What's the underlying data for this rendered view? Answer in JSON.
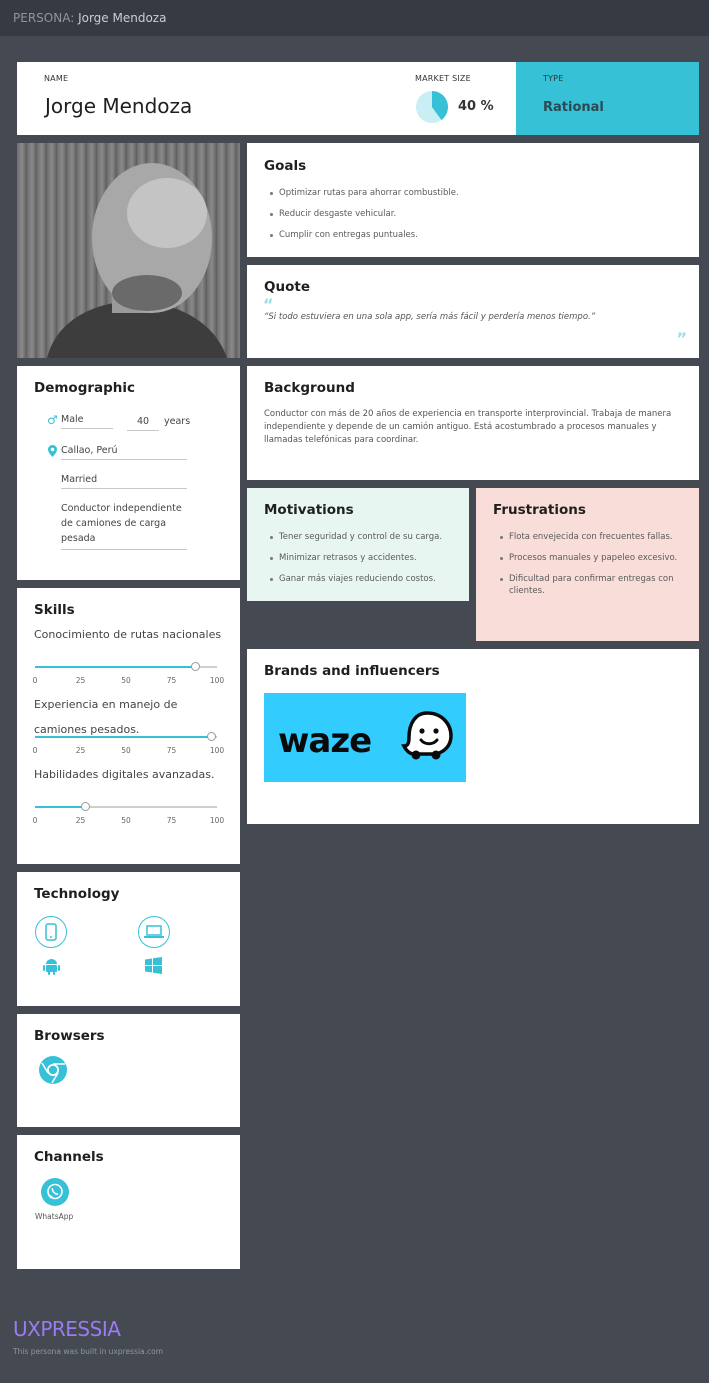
{
  "topbar": {
    "prefix": "PERSONA:",
    "name": "Jorge Mendoza"
  },
  "header": {
    "name_label": "NAME",
    "name": "Jorge Mendoza",
    "market_label": "MARKET SIZE",
    "market_value": "40 %",
    "market_fraction": 0.4,
    "type_label": "TYPE",
    "type_value": "Rational"
  },
  "colors": {
    "accent": "#36c1d6",
    "background": "#454a52",
    "motivations": "#e8f6f1",
    "frustrations": "#f8ddd8",
    "brand": "#9b7bf1"
  },
  "goals": {
    "title": "Goals",
    "items": [
      "Optimizar rutas para ahorrar combustible.",
      "Reducir desgaste vehicular.",
      "Cumplir con entregas puntuales."
    ]
  },
  "quote": {
    "title": "Quote",
    "text": "“Si todo estuviera en una sola app, sería más fácil y perdería menos tiempo.”"
  },
  "demographic": {
    "title": "Demographic",
    "gender": "Male",
    "age": "40",
    "age_unit": "years",
    "location": "Callao, Perú",
    "status": "Married",
    "occupation": "Conductor independiente de camiones de carga pesada"
  },
  "background": {
    "title": "Background",
    "text": "Conductor con más de 20 años de experiencia en transporte interprovincial. Trabaja de manera independiente y depende de un camión antiguo. Está acostumbrado a procesos manuales y llamadas telefónicas para coordinar."
  },
  "motivations": {
    "title": "Motivations",
    "items": [
      "Tener seguridad y control de su carga.",
      "Minimizar retrasos y accidentes.",
      "Ganar más viajes reduciendo costos."
    ]
  },
  "frustrations": {
    "title": "Frustrations",
    "items": [
      "Flota envejecida con frecuentes fallas.",
      "Procesos manuales y papeleo excesivo.",
      "Dificultad para confirmar entregas con clientes."
    ]
  },
  "skills": {
    "title": "Skills",
    "ticks": [
      "0",
      "25",
      "50",
      "75",
      "100"
    ],
    "items": [
      {
        "label": "Conocimiento de rutas nacionales",
        "value": 88
      },
      {
        "label": "Experiencia en manejo de camiones pesados.",
        "value": 97
      },
      {
        "label": "Habilidades digitales avanzadas.",
        "value": 28
      }
    ]
  },
  "brands": {
    "title": "Brands and influencers",
    "logo_text": "waze"
  },
  "technology": {
    "title": "Technology",
    "icons": [
      "smartphone-icon",
      "laptop-icon",
      "android-icon",
      "windows-icon"
    ]
  },
  "browsers": {
    "title": "Browsers",
    "icons": [
      "chrome-icon"
    ]
  },
  "channels": {
    "title": "Channels",
    "items": [
      {
        "label": "WhatsApp",
        "icon": "whatsapp-icon"
      }
    ]
  },
  "footer": {
    "brand": "UXPRESSIA",
    "note": "This persona was built in uxpressia.com"
  }
}
